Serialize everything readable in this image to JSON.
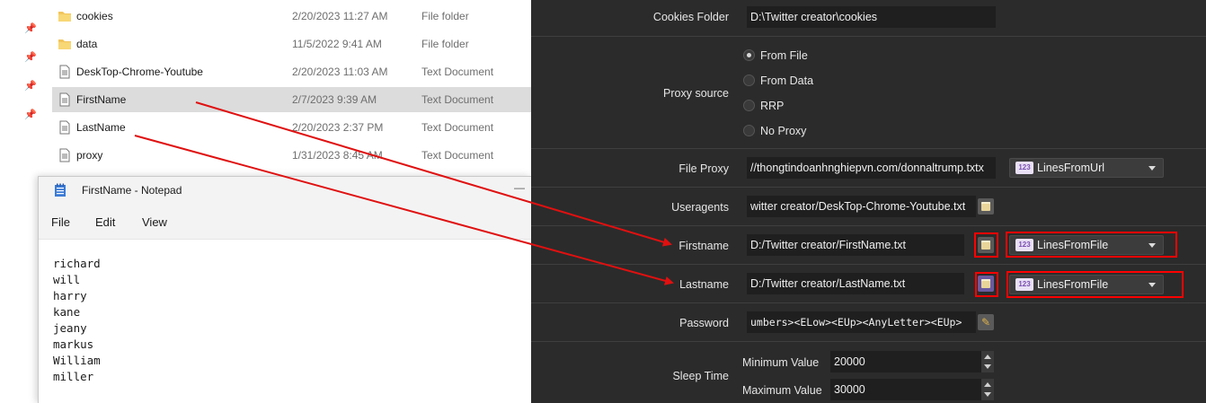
{
  "explorer": {
    "files": [
      {
        "name": "cookies",
        "date": "2/20/2023 11:27 AM",
        "type": "File folder",
        "icon": "folder-icon",
        "selected": false
      },
      {
        "name": "data",
        "date": "11/5/2022 9:41 AM",
        "type": "File folder",
        "icon": "folder-icon",
        "selected": false
      },
      {
        "name": "DeskTop-Chrome-Youtube",
        "date": "2/20/2023 11:03 AM",
        "type": "Text Document",
        "icon": "text-file-icon",
        "selected": false
      },
      {
        "name": "FirstName",
        "date": "2/7/2023 9:39 AM",
        "type": "Text Document",
        "icon": "text-file-icon",
        "selected": true
      },
      {
        "name": "LastName",
        "date": "2/20/2023 2:37 PM",
        "type": "Text Document",
        "icon": "text-file-icon",
        "selected": false
      },
      {
        "name": "proxy",
        "date": "1/31/2023 8:45 AM",
        "type": "Text Document",
        "icon": "text-file-icon",
        "selected": false
      }
    ]
  },
  "notepad": {
    "title": "FirstName - Notepad",
    "menu": {
      "file": "File",
      "edit": "Edit",
      "view": "View"
    },
    "lines": [
      "richard",
      "will",
      "harry",
      "kane",
      "jeany",
      "markus",
      "William",
      "miller"
    ]
  },
  "settings": {
    "cookies_folder": {
      "label": "Cookies Folder",
      "value": "D:\\Twitter creator\\cookies"
    },
    "proxy_source": {
      "label": "Proxy source",
      "options": [
        "From File",
        "From Data",
        "RRP",
        "No Proxy"
      ],
      "selected": "From File"
    },
    "file_proxy": {
      "label": "File Proxy",
      "value": "//thongtindoanhnghiepvn.com/donnaltrump.txtx",
      "mode": "LinesFromUrl"
    },
    "useragents": {
      "label": "Useragents",
      "value": "witter creator/DeskTop-Chrome-Youtube.txt"
    },
    "firstname": {
      "label": "Firstname",
      "value": "D:/Twitter creator/FirstName.txt",
      "mode": "LinesFromFile"
    },
    "lastname": {
      "label": "Lastname",
      "value": "D:/Twitter creator/LastName.txt",
      "mode": "LinesFromFile"
    },
    "password": {
      "label": "Password",
      "value": "umbers><ELow><EUp><AnyLetter><EUp>"
    },
    "sleep_time": {
      "label": "Sleep Time",
      "min_label": "Minimum Value",
      "min_value": "20000",
      "max_label": "Maximum Value",
      "max_value": "30000"
    },
    "mode_tag": "123"
  },
  "colors": {
    "highlight": "#ff0000",
    "arrow": "#e01010",
    "panel_bg": "#2b2b2b",
    "field_bg": "#1f1f1f"
  }
}
